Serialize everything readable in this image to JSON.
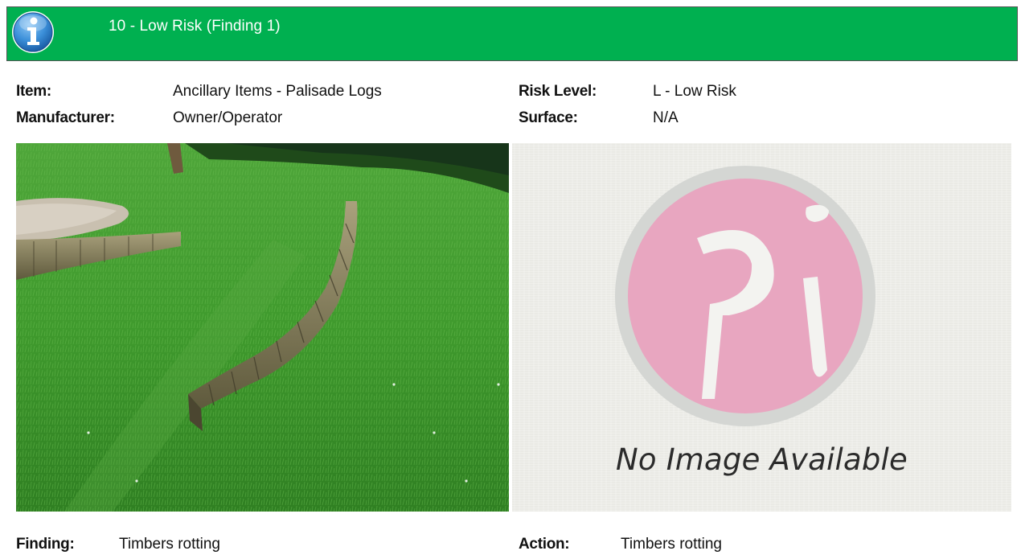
{
  "header": {
    "title": "10 - Low Risk (Finding 1)",
    "icon": "info-icon",
    "color": "#00b050"
  },
  "details": {
    "item_label": "Item:",
    "item_value": "Ancillary Items - Palisade Logs",
    "manufacturer_label": "Manufacturer:",
    "manufacturer_value": "Owner/Operator",
    "risk_label": "Risk Level:",
    "risk_value": "L - Low Risk",
    "surface_label": "Surface:",
    "surface_value": "N/A"
  },
  "images": {
    "photo_icon": "palisade-photo",
    "placeholder_icon": "pi-logo",
    "placeholder_text": "No Image Available"
  },
  "footer": {
    "finding_label": "Finding:",
    "finding_value": "Timbers rotting",
    "action_label": "Action:",
    "action_value": "Timbers rotting"
  }
}
